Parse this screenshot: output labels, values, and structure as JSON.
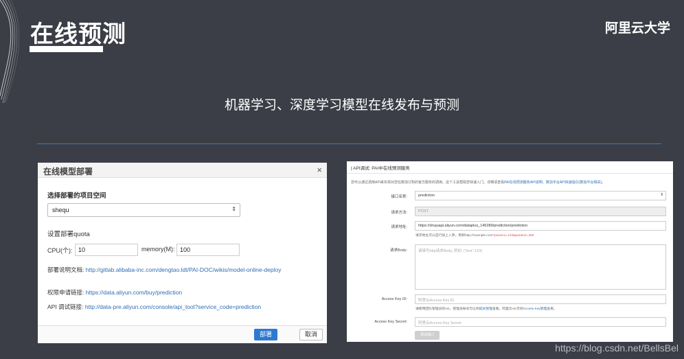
{
  "slide": {
    "title": "在线预测",
    "brand": "阿里云大学",
    "subtitle": "机器学习、深度学习模型在线发布与预测",
    "watermark": "https://blog.csdn.net/BellsBel"
  },
  "deploy_dialog": {
    "title": "在线模型部署",
    "close_icon": "×",
    "project_label": "选择部署的项目空间",
    "project_value": "shequ",
    "select_arrow": "⇕",
    "quota_label": "设置部署quota",
    "cpu_label": "CPU(个):",
    "cpu_value": "10",
    "memory_label": "memory(M):",
    "memory_value": "100",
    "doc_label": "部署说明文档:",
    "doc_link": "http://gitlab.alibaba-inc.com/dengtao.ldt/PAI-DOC/wikis/model-online-deploy",
    "apply_label": "权限申请链接:",
    "apply_link": "https://data.aliyun.com/buy/prediction",
    "api_label": "API 调试链接:",
    "api_link": "http://data-pre.aliyun.com/console/api_tool?service_code=prediction",
    "deploy_button": "部署",
    "cancel_button": "取消"
  },
  "api_panel": {
    "header": "| API调试: PAI中在线预测服务",
    "intro": "您可以通过调用API来实现对您在数加订购的官方服务的调用。这个工具帮助您快速入门。详细请查看",
    "intro_link": "PAI在线预测服务API说明、数加平台API快速指引(数加平台相关)",
    "intro_end": "。",
    "fields": {
      "interface_label": "接口名称:",
      "interface_value": "prediction",
      "method_label": "请求方法:",
      "method_value": "POST",
      "url_label": "请求地址:",
      "url_value": "https://shujuapi.aliyun.com/dataplus_145289/prediction/prediction",
      "url_help": "请求地址可以自行加上入参。例如http://example.com",
      "url_help_red": "?param1=123&param2=456",
      "body_label": "请求Body:",
      "body_placeholder": "请填写http请求Body, 例如: {\"test\":123}",
      "key_id_label": "Access Key ID:",
      "key_id_placeholder": "阿里云Access Key ID",
      "key_help": "请使用团队管理员的AK。管理员帐号可以到",
      "key_help_link1": "成员管理",
      "key_help_mid": "查看。阿里云AK可到",
      "key_help_link2": "Access Key管理",
      "key_help_end": "查看。",
      "secret_label": "Access Key Secret:",
      "secret_placeholder": "阿里云Access Key Secret",
      "submit_button": "调试接口"
    }
  }
}
